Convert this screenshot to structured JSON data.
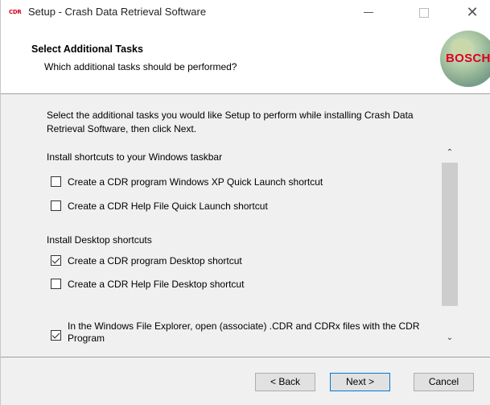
{
  "window": {
    "app_icon_text": "CDR",
    "title": "Setup - Crash Data Retrieval Software",
    "minimize_icon": "minimize-icon",
    "maximize_icon": "maximize-icon",
    "close_glyph": "✕"
  },
  "header": {
    "title": "Select Additional Tasks",
    "subtitle": "Which additional tasks should be performed?",
    "logo_text": "BOSCH"
  },
  "intro": "Select the additional tasks you would like Setup to perform while installing Crash Data Retrieval Software, then click Next.",
  "groups": [
    {
      "label": "Install shortcuts to your Windows taskbar",
      "items": [
        {
          "label": "Create a CDR program Windows XP Quick Launch shortcut",
          "checked": false
        },
        {
          "label": "Create a CDR Help File Quick Launch shortcut",
          "checked": false
        }
      ]
    },
    {
      "label": "Install Desktop shortcuts",
      "items": [
        {
          "label": "Create a CDR program Desktop shortcut",
          "checked": true
        },
        {
          "label": "Create a CDR Help File Desktop shortcut",
          "checked": false
        }
      ]
    }
  ],
  "associate": {
    "label": "In the Windows File Explorer, open (associate) .CDR and CDRx files with the CDR Program",
    "checked": true
  },
  "scrollbar": {
    "up_glyph": "⌃",
    "down_glyph": "⌄"
  },
  "buttons": {
    "back": "< Back",
    "next": "Next >",
    "cancel": "Cancel"
  },
  "colors": {
    "logo_red": "#e0001b",
    "default_button_border": "#0078d7"
  }
}
